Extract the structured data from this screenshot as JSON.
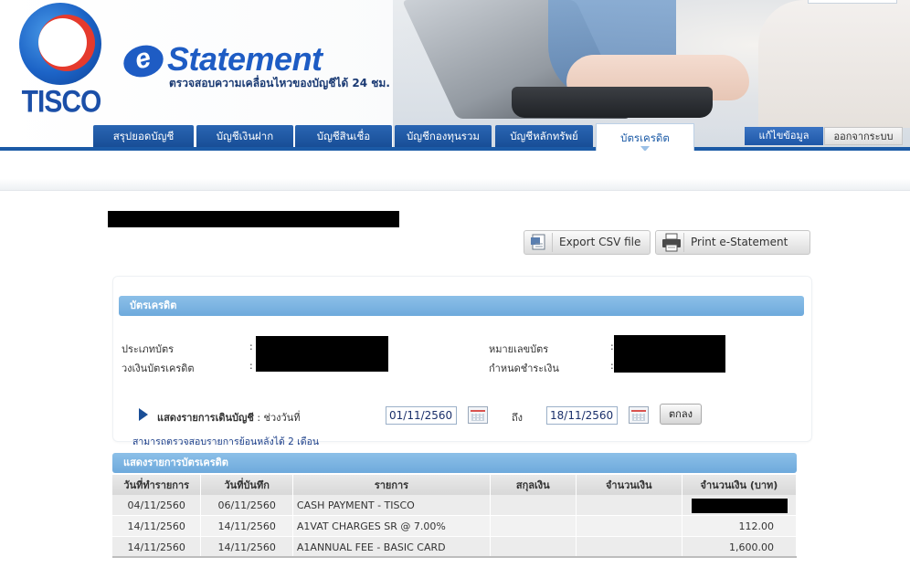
{
  "brand": {
    "logo_text": "TISCO",
    "app_title": "Statement",
    "app_prefix": "e",
    "tagline": "ตรวจสอบความเคลื่อนไหวของบัญชีได้ 24 ชม."
  },
  "nav": {
    "tabs": [
      {
        "label": "สรุปยอดบัญชี"
      },
      {
        "label": "บัญชีเงินฝาก"
      },
      {
        "label": "บัญชีสินเชื่อ"
      },
      {
        "label": "บัญชีกองทุนรวม"
      },
      {
        "label": "บัญชีหลักทรัพย์"
      },
      {
        "label": "บัตรเครดิต"
      }
    ],
    "edit_label": "แก้ไขข้อมูล",
    "logout_label": "ออกจากระบบ"
  },
  "actions": {
    "export_label": "Export CSV file",
    "print_label": "Print e-Statement"
  },
  "card_info": {
    "section_title": "บัตรเครดิต",
    "card_type_label": "ประเภทบัตร",
    "credit_limit_label": "วงเงินบัตรเครดิต",
    "card_number_label": "หมายเลขบัตร",
    "due_date_label": "กำหนดชำระเงิน",
    "colon": ":"
  },
  "filter": {
    "label_bold": "แสดงรายการเดินบัญชี",
    "label_normal": " : ช่วงวันที่",
    "from_date": "01/11/2560",
    "to_label": "ถึง",
    "to_date": "18/11/2560",
    "submit_label": "ตกลง",
    "note": "สามารถตรวจสอบรายการย้อนหลังได้ 2 เดือน"
  },
  "transactions": {
    "section_title": "แสดงรายการบัตรเครดิต",
    "headers": [
      "วันที่ทำรายการ",
      "วันที่บันทึก",
      "รายการ",
      "สกุลเงิน",
      "จำนวนเงิน",
      "จำนวนเงิน (บาท)"
    ],
    "rows": [
      {
        "txn_date": "04/11/2560",
        "post_date": "06/11/2560",
        "desc": "CASH PAYMENT - TISCO",
        "currency": "",
        "amount": "",
        "amount_thb": ""
      },
      {
        "txn_date": "14/11/2560",
        "post_date": "14/11/2560",
        "desc": "A1VAT CHARGES SR @ 7.00%",
        "currency": "",
        "amount": "",
        "amount_thb": "112.00"
      },
      {
        "txn_date": "14/11/2560",
        "post_date": "14/11/2560",
        "desc": "A1ANNUAL FEE - BASIC CARD",
        "currency": "",
        "amount": "",
        "amount_thb": "1,600.00"
      }
    ]
  },
  "colors": {
    "nav_blue": "#1b5aa6",
    "section_bar": "#7fb6e2",
    "brand_blue": "#1e5cc4",
    "logo_red": "#e53a2d"
  }
}
